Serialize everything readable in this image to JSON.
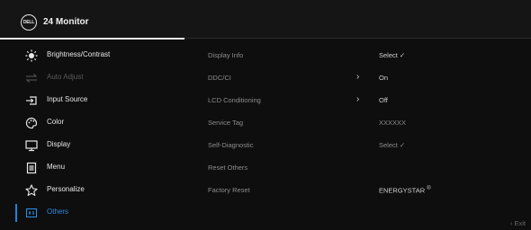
{
  "header": {
    "logo_text": "DELL",
    "title": "24 Monitor"
  },
  "menu": [
    {
      "label": "Brightness/Contrast",
      "icon": "brightness-icon",
      "state": "normal"
    },
    {
      "label": "Auto Adjust",
      "icon": "auto-adjust-icon",
      "state": "disabled"
    },
    {
      "label": "Input Source",
      "icon": "input-source-icon",
      "state": "normal"
    },
    {
      "label": "Color",
      "icon": "color-palette-icon",
      "state": "normal"
    },
    {
      "label": "Display",
      "icon": "display-icon",
      "state": "normal"
    },
    {
      "label": "Menu",
      "icon": "menu-icon",
      "state": "normal"
    },
    {
      "label": "Personalize",
      "icon": "star-icon",
      "state": "normal"
    },
    {
      "label": "Others",
      "icon": "others-icon",
      "state": "active"
    }
  ],
  "options": [
    {
      "label": "Display Info",
      "value": "Select ✓"
    },
    {
      "label": "DDC/CI",
      "arrow": "›",
      "value": "On"
    },
    {
      "label": "LCD Conditioning",
      "arrow": "›",
      "value": "Off"
    },
    {
      "label": "Service Tag",
      "value": "XXXXXX"
    },
    {
      "label": "Self-Diagnostic",
      "value": "Select ✓"
    },
    {
      "label": "Reset Others",
      "value": ""
    },
    {
      "label": "Factory Reset",
      "value": "ENERGYSTAR",
      "value_sup": "®"
    }
  ],
  "footer": {
    "exit_label": "‹ Exit"
  },
  "colors": {
    "accent": "#1e84d8",
    "background": "#0e0e0e"
  }
}
